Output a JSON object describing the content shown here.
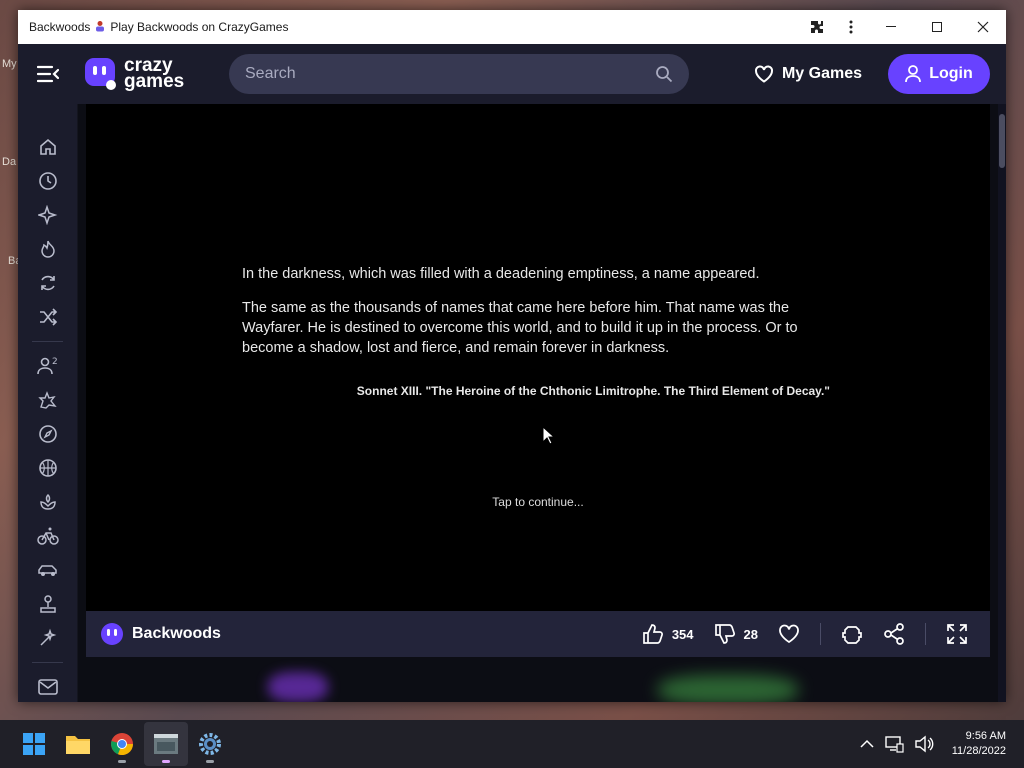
{
  "desktop": {
    "frag1": "My",
    "frag2": "Da",
    "frag3": "Ba"
  },
  "window": {
    "title": "Backwoods",
    "title_sep": "Play Backwoods on CrazyGames"
  },
  "nav": {
    "logo_line1": "crazy",
    "logo_line2": "games",
    "search_placeholder": "Search",
    "my_games": "My Games",
    "login": "Login"
  },
  "sidebar": {
    "items": [
      "home-icon",
      "clock-icon",
      "sparkle-icon",
      "fire-icon",
      "refresh-icon",
      "shuffle-icon",
      "users-icon",
      "explosion-icon",
      "compass-icon",
      "basketball-icon",
      "flower-icon",
      "bicycle-icon",
      "car-icon",
      "joystick-icon",
      "magic-icon"
    ],
    "bottom": "mail-icon"
  },
  "game": {
    "para1": "In the darkness, which was filled with a deadening emptiness, a name appeared.",
    "para2": "The same as the thousands of names that came here before him. That name was the Wayfarer. He is destined to overcome this world, and to build it up in the process. Or to become a shadow, lost and fierce, and remain forever in darkness.",
    "sonnet": "Sonnet XIII. \"The Heroine of the Chthonic Limitrophe. The Third Element of Decay.\"",
    "tap": "Tap to continue..."
  },
  "gamebar": {
    "title": "Backwoods",
    "likes": "354",
    "dislikes": "28"
  },
  "taskbar": {
    "time": "9:56 AM",
    "date": "11/28/2022"
  },
  "colors": {
    "accent": "#6842ff",
    "nav_bg": "#1b1c2c"
  }
}
